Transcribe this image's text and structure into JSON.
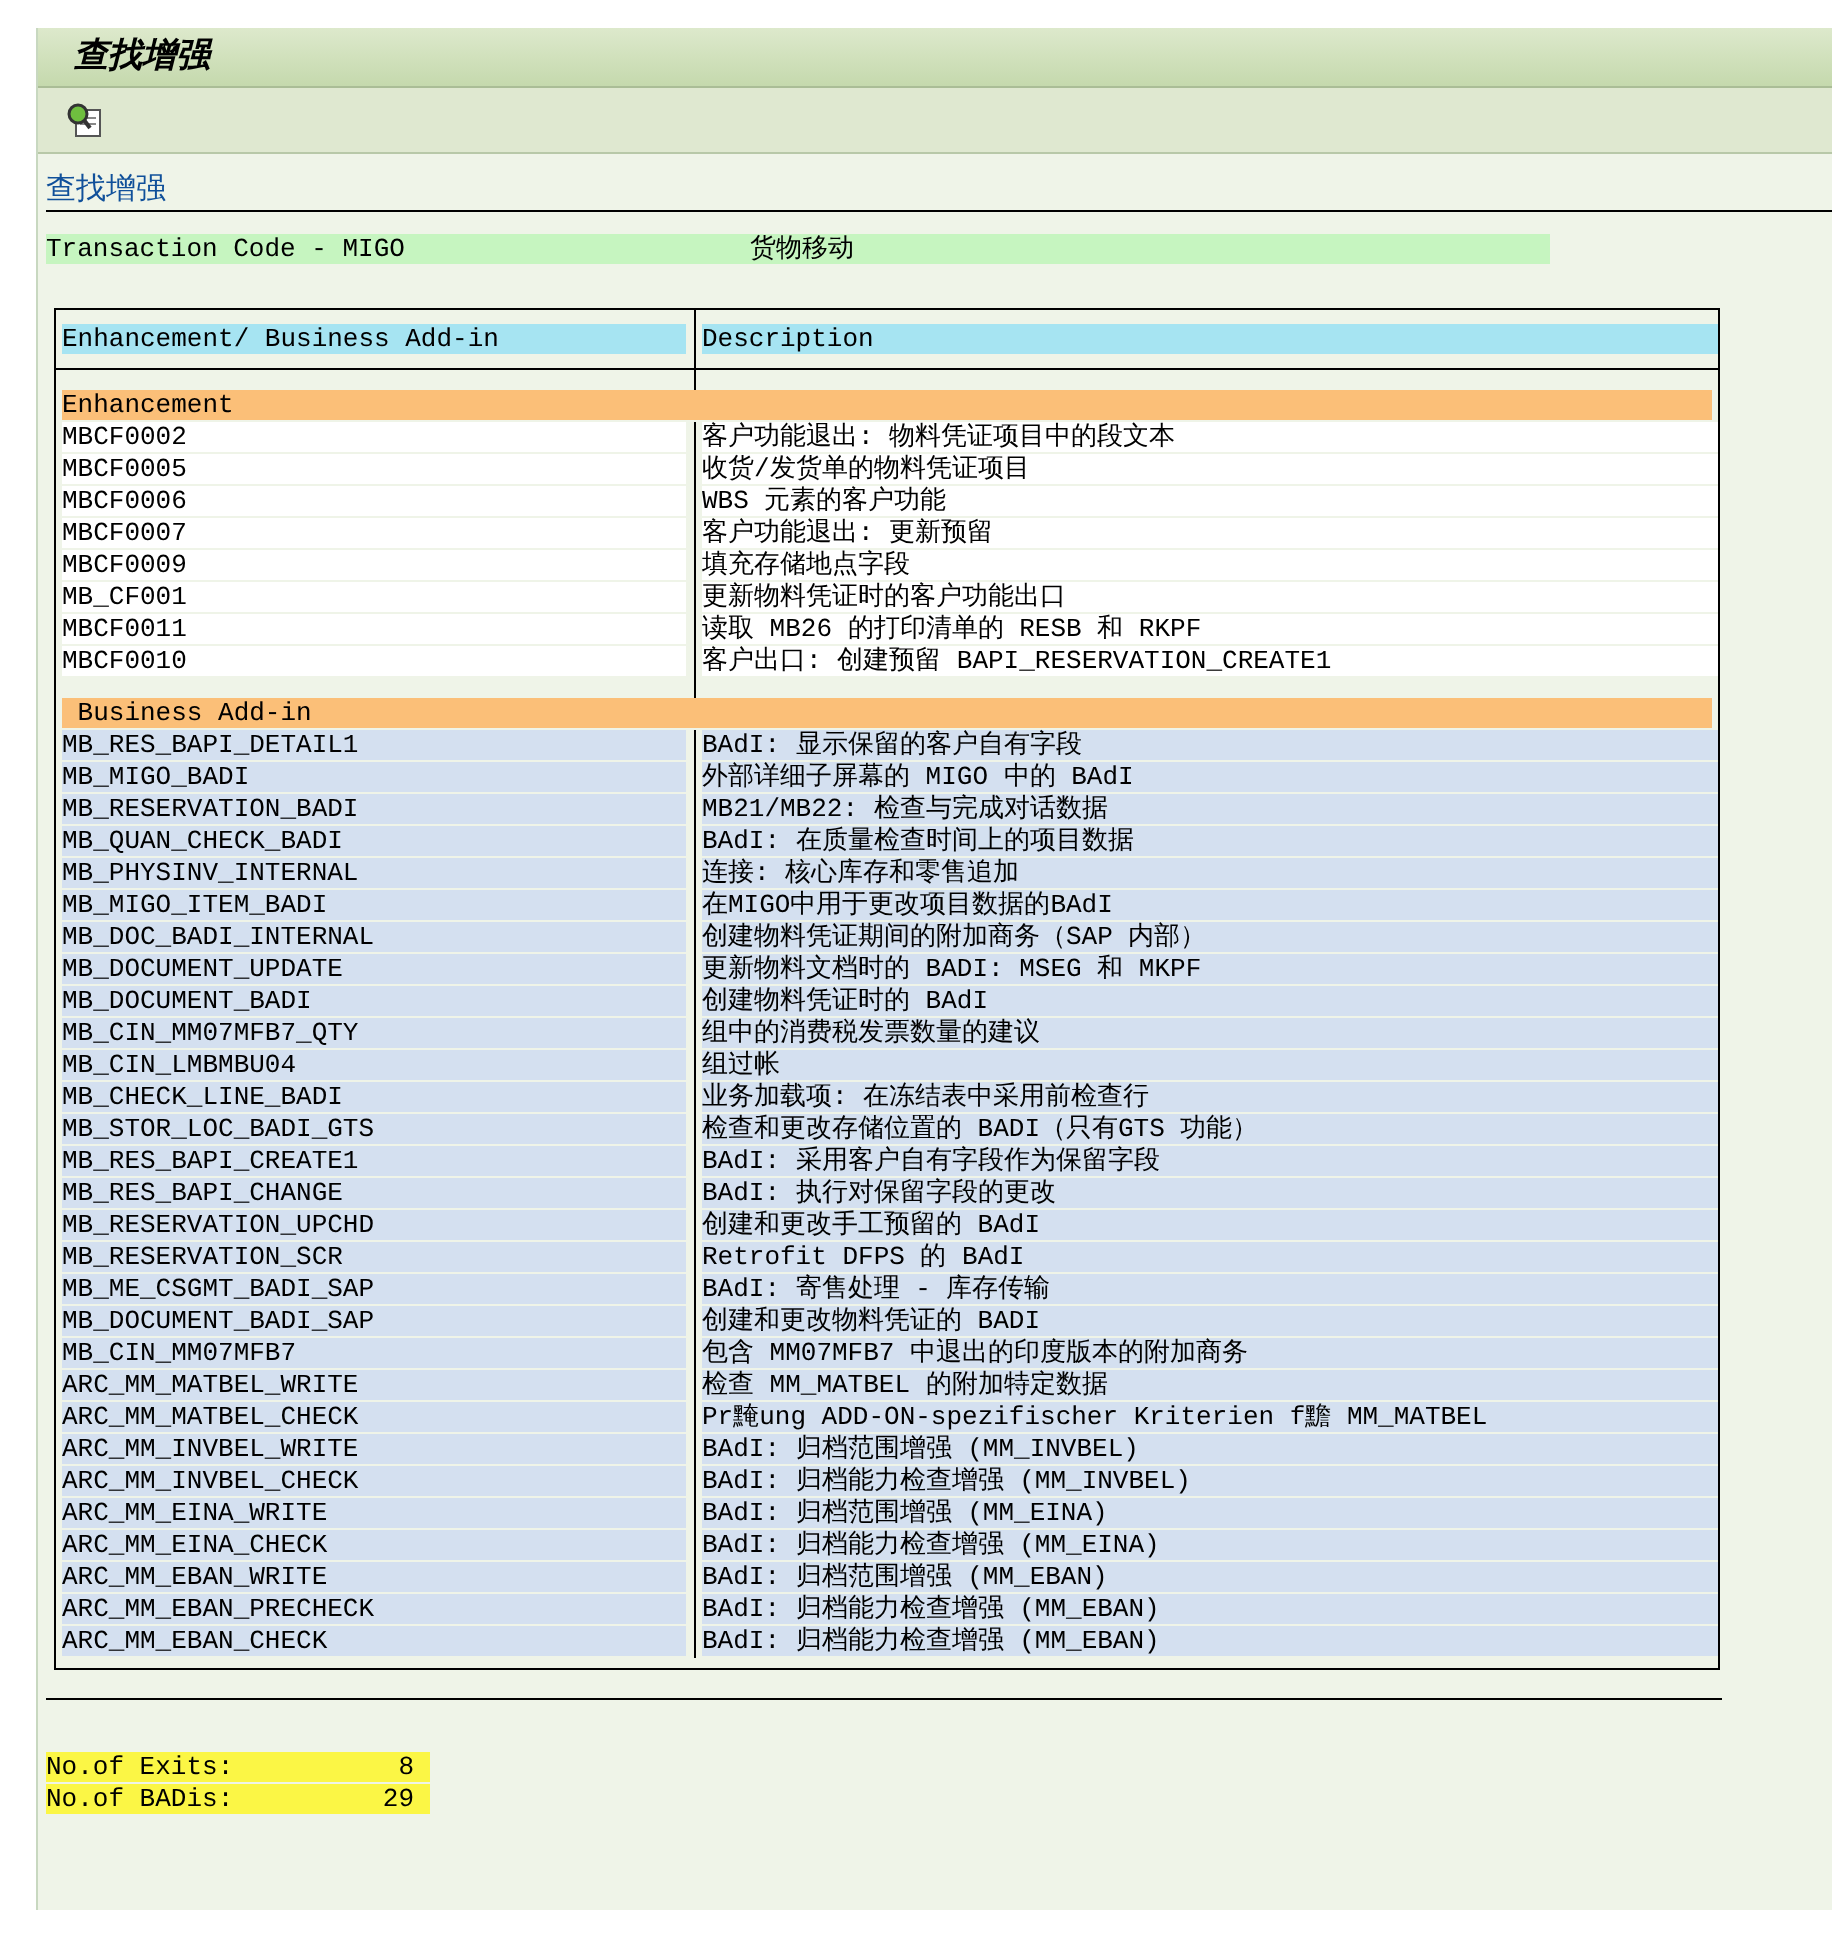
{
  "window": {
    "title": "查找增强"
  },
  "toolbar": {
    "buttons": [
      {
        "kind": "find"
      }
    ]
  },
  "link": "查找增强",
  "transaction": {
    "label": "Transaction Code - MIGO",
    "description": "货物移动"
  },
  "table": {
    "columns": [
      "Enhancement/ Business Add-in",
      "Description"
    ],
    "sections": [
      {
        "title": "Enhancement",
        "kind": "exit",
        "rows": [
          {
            "name": "MBCF0002",
            "description": "客户功能退出: 物料凭证项目中的段文本"
          },
          {
            "name": "MBCF0005",
            "description": "收货/发货单的物料凭证项目"
          },
          {
            "name": "MBCF0006",
            "description": "WBS 元素的客户功能"
          },
          {
            "name": "MBCF0007",
            "description": "客户功能退出: 更新预留"
          },
          {
            "name": "MBCF0009",
            "description": "填充存储地点字段"
          },
          {
            "name": "MB_CF001",
            "description": "更新物料凭证时的客户功能出口"
          },
          {
            "name": "MBCF0011",
            "description": "读取 MB26 的打印清单的 RESB 和 RKPF"
          },
          {
            "name": "MBCF0010",
            "description": "客户出口: 创建预留 BAPI_RESERVATION_CREATE1"
          }
        ]
      },
      {
        "title": " Business Add-in",
        "kind": "badi",
        "rows": [
          {
            "name": "MB_RES_BAPI_DETAIL1",
            "description": "BAdI: 显示保留的客户自有字段"
          },
          {
            "name": "MB_MIGO_BADI",
            "description": "外部详细子屏幕的 MIGO 中的 BAdI"
          },
          {
            "name": "MB_RESERVATION_BADI",
            "description": "MB21/MB22: 检查与完成对话数据"
          },
          {
            "name": "MB_QUAN_CHECK_BADI",
            "description": "BAdI: 在质量检查时间上的项目数据"
          },
          {
            "name": "MB_PHYSINV_INTERNAL",
            "description": "连接: 核心库存和零售追加"
          },
          {
            "name": "MB_MIGO_ITEM_BADI",
            "description": "在MIGO中用于更改项目数据的BAdI"
          },
          {
            "name": "MB_DOC_BADI_INTERNAL",
            "description": "创建物料凭证期间的附加商务（SAP 内部）"
          },
          {
            "name": "MB_DOCUMENT_UPDATE",
            "description": "更新物料文档时的 BADI: MSEG 和 MKPF"
          },
          {
            "name": "MB_DOCUMENT_BADI",
            "description": "创建物料凭证时的 BAdI"
          },
          {
            "name": "MB_CIN_MM07MFB7_QTY",
            "description": "组中的消费税发票数量的建议"
          },
          {
            "name": "MB_CIN_LMBMBU04",
            "description": "组过帐"
          },
          {
            "name": "MB_CHECK_LINE_BADI",
            "description": "业务加载项: 在冻结表中采用前检查行"
          },
          {
            "name": "MB_STOR_LOC_BADI_GTS",
            "description": "检查和更改存储位置的 BADI（只有GTS 功能）"
          },
          {
            "name": "MB_RES_BAPI_CREATE1",
            "description": "BAdI: 采用客户自有字段作为保留字段"
          },
          {
            "name": "MB_RES_BAPI_CHANGE",
            "description": "BAdI: 执行对保留字段的更改"
          },
          {
            "name": "MB_RESERVATION_UPCHD",
            "description": "创建和更改手工预留的 BAdI"
          },
          {
            "name": "MB_RESERVATION_SCR",
            "description": "Retrofit DFPS 的 BAdI"
          },
          {
            "name": "MB_ME_CSGMT_BADI_SAP",
            "description": "BAdI: 寄售处理 - 库存传输"
          },
          {
            "name": "MB_DOCUMENT_BADI_SAP",
            "description": "创建和更改物料凭证的 BADI"
          },
          {
            "name": "MB_CIN_MM07MFB7",
            "description": "包含 MM07MFB7 中退出的印度版本的附加商务"
          },
          {
            "name": "ARC_MM_MATBEL_WRITE",
            "description": "检查 MM_MATBEL 的附加特定数据"
          },
          {
            "name": "ARC_MM_MATBEL_CHECK",
            "description": "Pr黤ung ADD-ON-spezifischer Kriterien f黵 MM_MATBEL"
          },
          {
            "name": "ARC_MM_INVBEL_WRITE",
            "description": "BAdI: 归档范围增强 (MM_INVBEL)"
          },
          {
            "name": "ARC_MM_INVBEL_CHECK",
            "description": "BAdI: 归档能力检查增强 (MM_INVBEL)"
          },
          {
            "name": "ARC_MM_EINA_WRITE",
            "description": "BAdI: 归档范围增强 (MM_EINA)"
          },
          {
            "name": "ARC_MM_EINA_CHECK",
            "description": "BAdI: 归档能力检查增强 (MM_EINA)"
          },
          {
            "name": "ARC_MM_EBAN_WRITE",
            "description": "BAdI: 归档范围增强 (MM_EBAN)"
          },
          {
            "name": "ARC_MM_EBAN_PRECHECK",
            "description": "BAdI: 归档能力检查增强 (MM_EBAN)"
          },
          {
            "name": "ARC_MM_EBAN_CHECK",
            "description": "BAdI: 归档能力检查增强 (MM_EBAN)"
          }
        ]
      }
    ]
  },
  "summary": [
    {
      "label": "No.of Exits:",
      "value": "8"
    },
    {
      "label": "No.of BADis:",
      "value": "29"
    }
  ]
}
